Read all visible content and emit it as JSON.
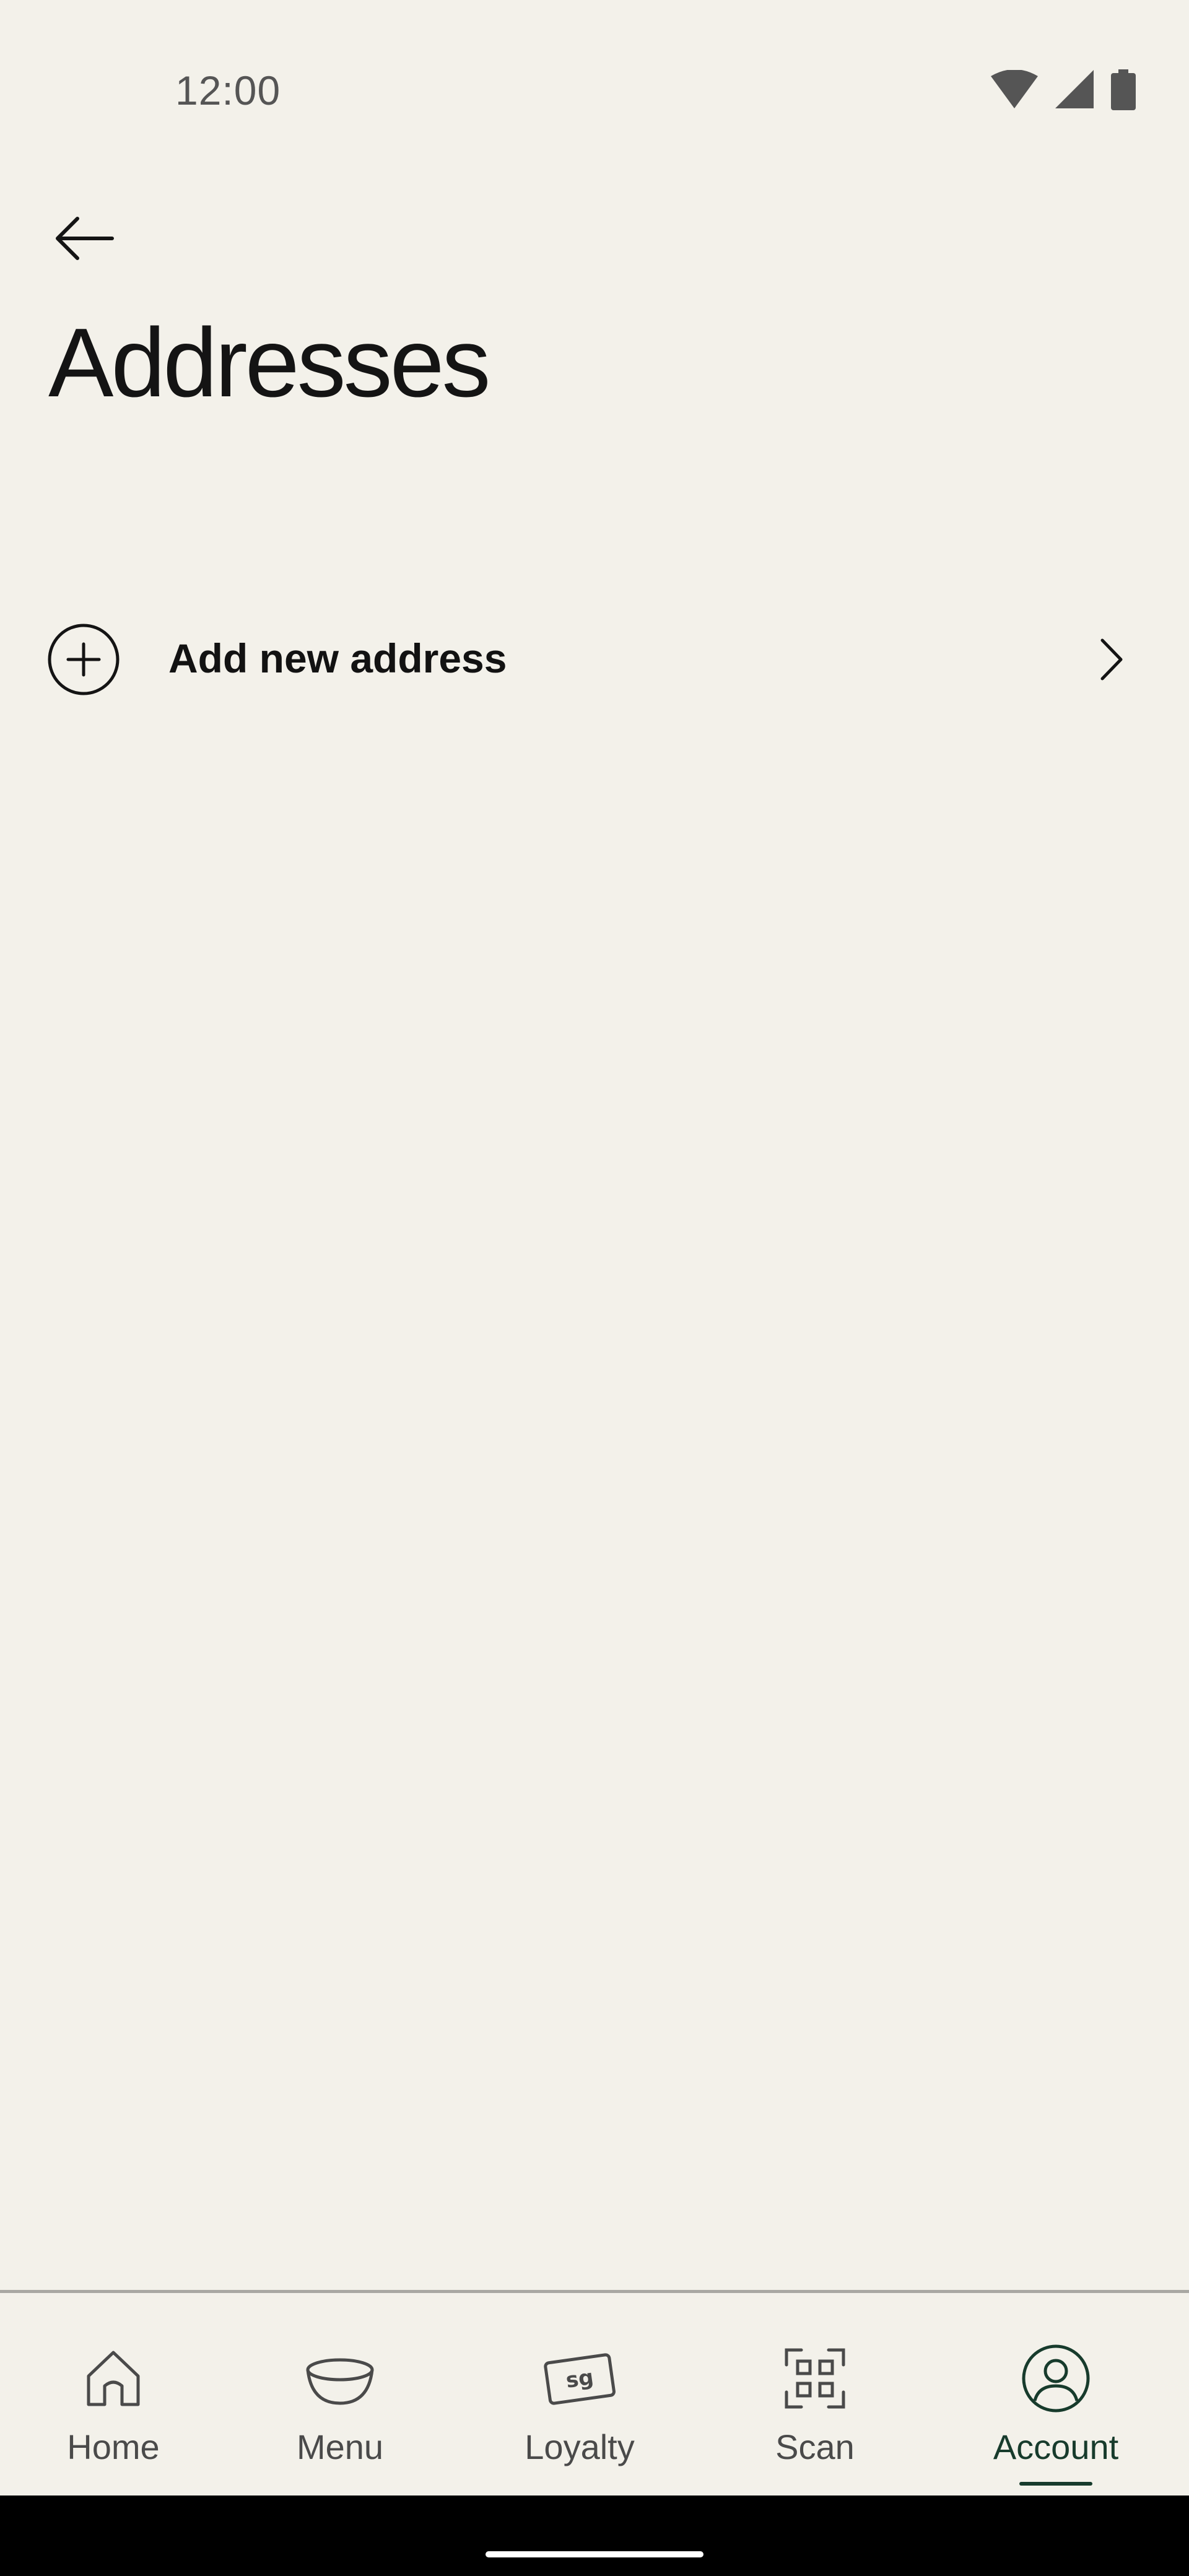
{
  "status_bar": {
    "time": "12:00"
  },
  "header": {
    "title": "Addresses"
  },
  "add_address": {
    "label": "Add new address"
  },
  "bottom_nav": {
    "items": [
      {
        "label": "Home",
        "icon": "home-icon"
      },
      {
        "label": "Menu",
        "icon": "bowl-icon"
      },
      {
        "label": "Loyalty",
        "icon": "loyalty-card-icon"
      },
      {
        "label": "Scan",
        "icon": "qr-scan-icon"
      },
      {
        "label": "Account",
        "icon": "account-icon",
        "active": true
      }
    ]
  },
  "colors": {
    "background": "#f3f1ea",
    "active_nav": "#173b2c",
    "text": "#111111"
  }
}
